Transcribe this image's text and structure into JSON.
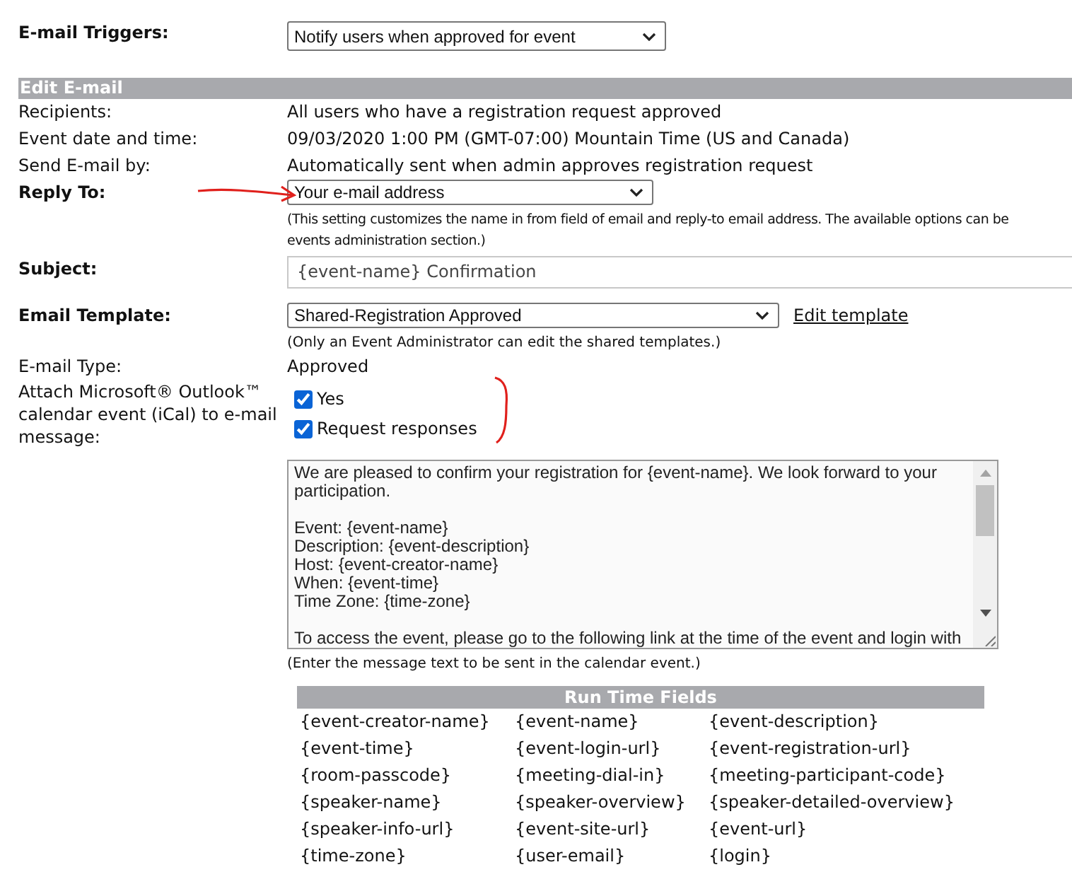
{
  "triggers": {
    "label": "E-mail Triggers:",
    "value": "Notify users when approved for event"
  },
  "section_title": "Edit E-mail",
  "info_rows": [
    {
      "label": "Recipients:",
      "value": "All users who have a registration request approved"
    },
    {
      "label": "Event date and time:",
      "value": "09/03/2020 1:00 PM  (GMT-07:00) Mountain Time (US and Canada)"
    },
    {
      "label": "Send E-mail by:",
      "value": "Automatically sent when admin approves registration request"
    }
  ],
  "reply_to": {
    "label": "Reply To:",
    "value": "Your e-mail address",
    "hint_lines": [
      "(This setting customizes the name in from field of email and reply-to email address. The available options can be",
      "events administration section.)"
    ]
  },
  "subject": {
    "label": "Subject:",
    "value": "{event-name} Confirmation"
  },
  "template": {
    "label": "Email Template:",
    "value": "Shared-Registration Approved",
    "link": "Edit template",
    "hint": "(Only an Event Administrator can edit the shared templates.)"
  },
  "email_type": {
    "label": "E-mail Type:",
    "value": "Approved"
  },
  "attach": {
    "label": "Attach Microsoft® Outlook™ calendar event (iCal) to e-mail message:",
    "options": [
      {
        "label": "Yes",
        "checked": true
      },
      {
        "label": "Request responses",
        "checked": true
      }
    ]
  },
  "message": {
    "paragraphs": [
      [
        "We are pleased to confirm your registration for {event-name}.  We look forward to your participation."
      ],
      [
        "Event: {event-name}",
        "Description: {event-description}",
        "Host: {event-creator-name}",
        "When: {event-time}",
        "Time Zone: {time-zone}"
      ],
      [
        "To access the event, please go to the following link at the time of the event and login with"
      ]
    ],
    "hint": "(Enter the message text to be sent in the calendar event.)"
  },
  "run_time_fields": {
    "title": "Run Time Fields",
    "rows": [
      [
        "{event-creator-name}",
        "{event-name}",
        "{event-description}"
      ],
      [
        "{event-time}",
        "{event-login-url}",
        "{event-registration-url}"
      ],
      [
        "{room-passcode}",
        "{meeting-dial-in}",
        "{meeting-participant-code}"
      ],
      [
        "{speaker-name}",
        "{speaker-overview}",
        "{speaker-detailed-overview}"
      ],
      [
        "{speaker-info-url}",
        "{event-site-url}",
        "{event-url}"
      ],
      [
        "{time-zone}",
        "{user-email}",
        "{login}"
      ]
    ]
  }
}
